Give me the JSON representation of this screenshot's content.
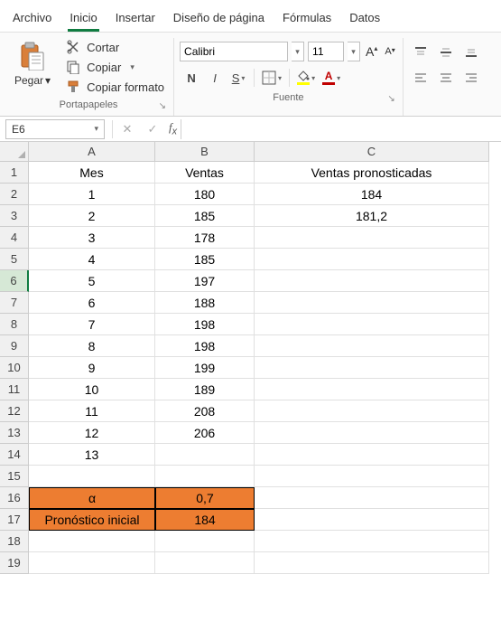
{
  "menu": {
    "items": [
      "Archivo",
      "Inicio",
      "Insertar",
      "Diseño de página",
      "Fórmulas",
      "Datos"
    ],
    "active_index": 1
  },
  "ribbon": {
    "clipboard": {
      "paste_label": "Pegar",
      "cut_label": "Cortar",
      "copy_label": "Copiar",
      "format_painter_label": "Copiar formato",
      "group_label": "Portapapeles"
    },
    "font": {
      "name": "Calibri",
      "size": "11",
      "group_label": "Fuente",
      "bold": "N",
      "italic": "I",
      "underline": "S",
      "fill_color": "#ffff00",
      "font_color": "#c00000"
    }
  },
  "namebox": {
    "value": "E6"
  },
  "formula_bar": {
    "value": ""
  },
  "sheet": {
    "columns": [
      "A",
      "B",
      "C"
    ],
    "active_row": 6,
    "headers": {
      "A": "Mes",
      "B": "Ventas",
      "C": "Ventas pronosticadas"
    },
    "rows": [
      {
        "n": 1,
        "A": "Mes",
        "B": "Ventas",
        "C": "Ventas pronosticadas",
        "is_header": true
      },
      {
        "n": 2,
        "A": "1",
        "B": "180",
        "C": "184"
      },
      {
        "n": 3,
        "A": "2",
        "B": "185",
        "C": "181,2"
      },
      {
        "n": 4,
        "A": "3",
        "B": "178",
        "C": ""
      },
      {
        "n": 5,
        "A": "4",
        "B": "185",
        "C": ""
      },
      {
        "n": 6,
        "A": "5",
        "B": "197",
        "C": ""
      },
      {
        "n": 7,
        "A": "6",
        "B": "188",
        "C": ""
      },
      {
        "n": 8,
        "A": "7",
        "B": "198",
        "C": ""
      },
      {
        "n": 9,
        "A": "8",
        "B": "198",
        "C": ""
      },
      {
        "n": 10,
        "A": "9",
        "B": "199",
        "C": ""
      },
      {
        "n": 11,
        "A": "10",
        "B": "189",
        "C": ""
      },
      {
        "n": 12,
        "A": "11",
        "B": "208",
        "C": ""
      },
      {
        "n": 13,
        "A": "12",
        "B": "206",
        "C": ""
      },
      {
        "n": 14,
        "A": "13",
        "B": "",
        "C": ""
      },
      {
        "n": 15,
        "A": "",
        "B": "",
        "C": ""
      },
      {
        "n": 16,
        "A": "α",
        "B": "0,7",
        "C": "",
        "orangeAB": true
      },
      {
        "n": 17,
        "A": "Pronóstico inicial",
        "B": "184",
        "C": "",
        "orangeAB": true
      },
      {
        "n": 18,
        "A": "",
        "B": "",
        "C": ""
      },
      {
        "n": 19,
        "A": "",
        "B": "",
        "C": ""
      }
    ]
  }
}
